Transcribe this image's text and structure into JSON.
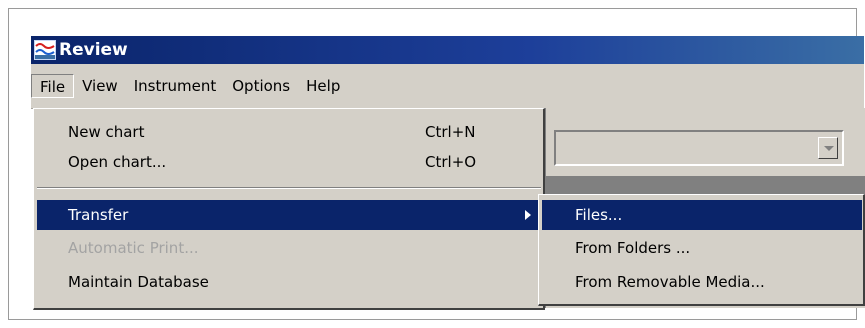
{
  "window": {
    "title": "Review",
    "icon": "review-app-icon"
  },
  "menubar": [
    "File",
    "View",
    "Instrument",
    "Options",
    "Help"
  ],
  "file_menu": {
    "items": [
      {
        "label": "New chart",
        "shortcut": "Ctrl+N"
      },
      {
        "label": "Open chart...",
        "shortcut": "Ctrl+O"
      },
      {
        "label": "Transfer",
        "submenu_icon": "chevron-right-icon"
      },
      {
        "label": "Automatic Print..."
      },
      {
        "label": "Maintain Database"
      }
    ]
  },
  "transfer_submenu": {
    "items": [
      {
        "label": "Files..."
      },
      {
        "label": "From Folders ..."
      },
      {
        "label": "From Removable Media..."
      }
    ]
  },
  "combo": {
    "value": "",
    "icon": "chevron-down-icon"
  },
  "colors": {
    "highlight": "#0a246a",
    "menu_bg": "#d4d0c8",
    "disabled_text": "#a3a3a3",
    "title_start": "#0a246a",
    "title_end": "#3a6ea5"
  }
}
